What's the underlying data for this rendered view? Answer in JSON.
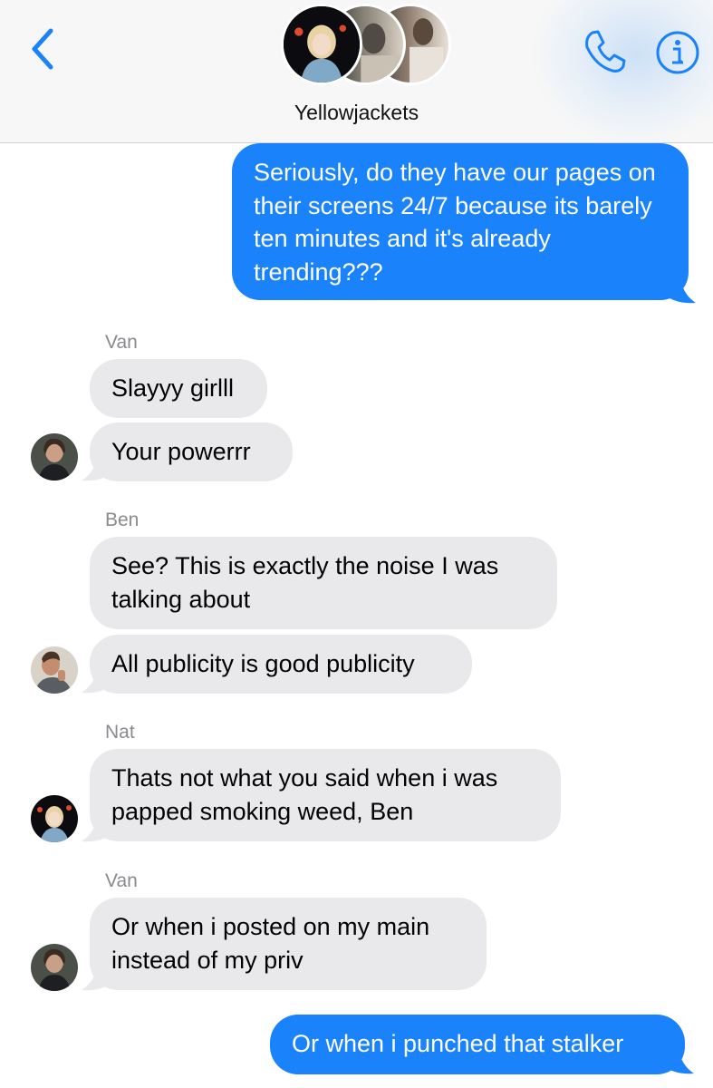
{
  "header": {
    "back_icon": "chevron-left-icon",
    "group_name": "Yellowjackets",
    "call_icon": "phone-icon",
    "info_icon": "info-icon",
    "accent": "#1a82fb"
  },
  "colors": {
    "sent_bubble": "#1a82fb",
    "received_bubble": "#e9e9eb",
    "sender_label": "#8a8a8f"
  },
  "messages": [
    {
      "direction": "sent",
      "text": "Seriously, do they have our pages on their screens 24/7 because its barely ten minutes and it's already trending???"
    },
    {
      "direction": "received",
      "sender": "Van",
      "text": "Slayyy girlll"
    },
    {
      "direction": "received",
      "sender": "Van",
      "text": "Your powerrr"
    },
    {
      "direction": "received",
      "sender": "Ben",
      "text": "See? This is exactly the noise I was talking about"
    },
    {
      "direction": "received",
      "sender": "Ben",
      "text": "All publicity is good publicity"
    },
    {
      "direction": "received",
      "sender": "Nat",
      "text": "Thats not what you said when i was papped smoking weed, Ben"
    },
    {
      "direction": "received",
      "sender": "Van",
      "text": "Or when i posted on my main instead of my priv"
    },
    {
      "direction": "sent",
      "text": "Or when i punched that stalker"
    }
  ],
  "sender_labels": [
    "Van",
    "Ben",
    "Nat",
    "Van"
  ]
}
